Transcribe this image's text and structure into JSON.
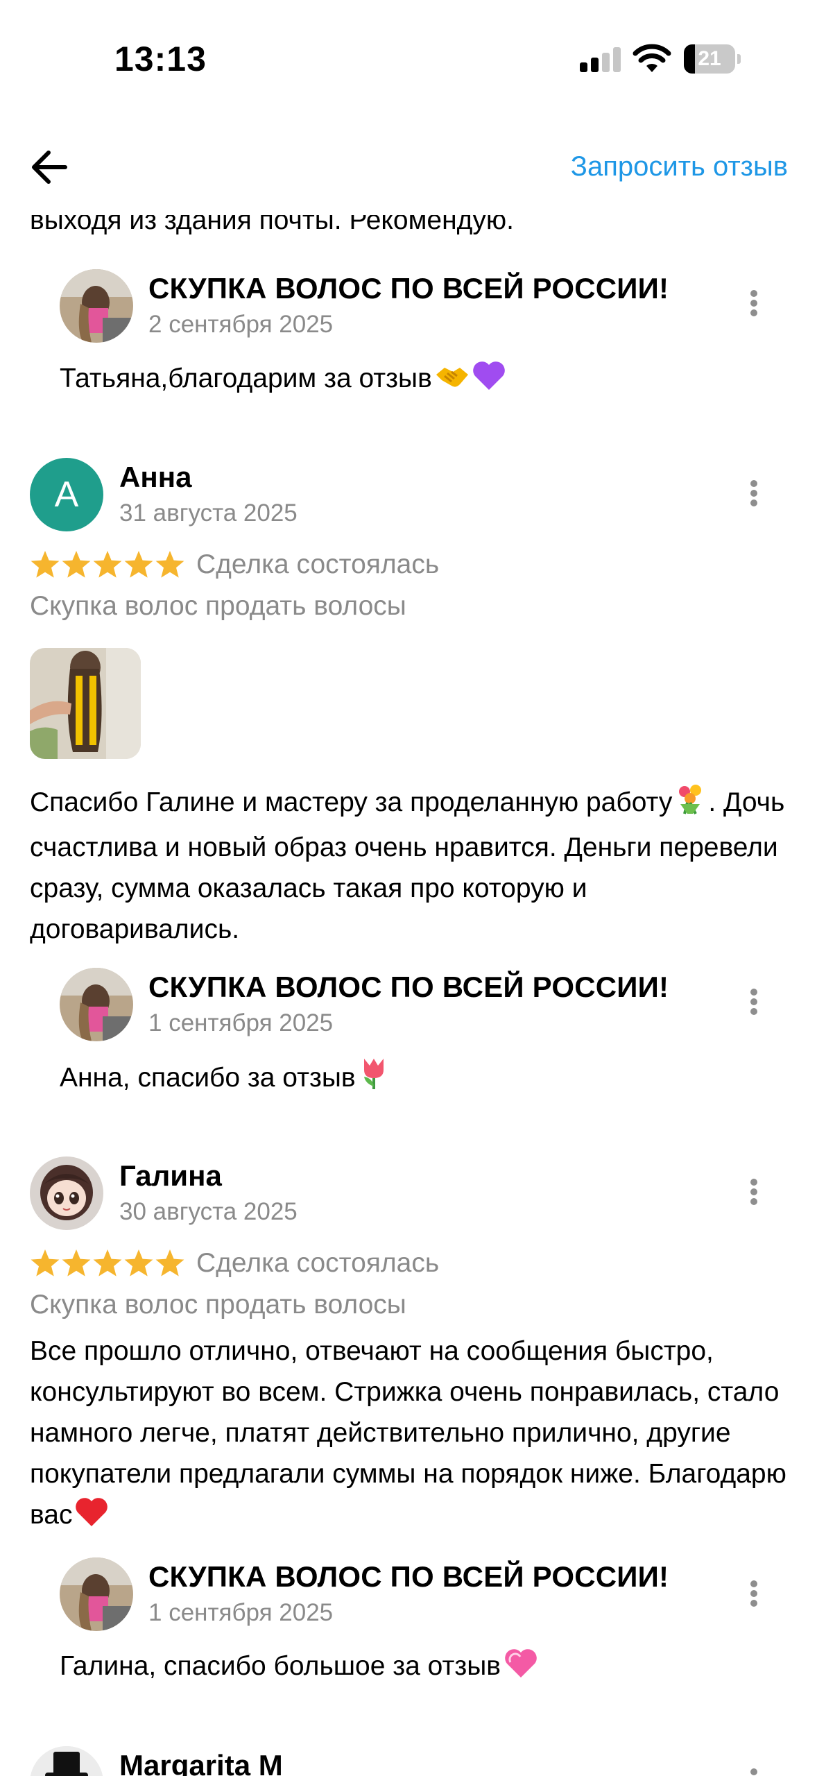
{
  "status_bar": {
    "time": "13:13",
    "battery": "21",
    "battery_level": 0.21
  },
  "nav": {
    "request_review_label": "Запросить отзыв"
  },
  "partial_top_text": "выходя из здания почты. Рекомендую.",
  "reviews": [
    {
      "reply": {
        "name": "СКУПКА ВОЛОС ПО ВСЕЙ РОССИИ!",
        "date": "2 сентября 2025",
        "text": "Татьяна,благодарим за отзыв",
        "emojis": [
          "handshake-emoji",
          "purple-heart-emoji"
        ]
      }
    },
    {
      "user": {
        "initial": "А",
        "avatar_color": "#1f9e8c",
        "name": "Анна",
        "date": "31 августа 2025",
        "rating": 5,
        "deal_status": "Сделка состоялась",
        "service": "Скупка волос продать волосы",
        "text": "Спасибо Галине и мастеру за проделанную работу",
        "text_after_emoji": ". Дочь счастлива и новый образ очень нравится. Деньги перевели сразу, сумма оказалась такая про которую и договаривались."
      },
      "reply": {
        "name": "СКУПКА ВОЛОС ПО ВСЕЙ РОССИИ!",
        "date": "1 сентября 2025",
        "text": "Анна, спасибо за отзыв",
        "emojis": [
          "tulip-emoji"
        ]
      }
    },
    {
      "user": {
        "name": "Галина",
        "date": "30 августа 2025",
        "rating": 5,
        "deal_status": "Сделка состоялась",
        "service": "Скупка волос продать волосы",
        "text": "Все прошло отлично, отвечают на сообщения быстро, консультируют во всем. Стрижка очень понравилась, стало намного легче, платят действительно прилично, другие покупатели предлагали суммы на порядок ниже. Благодарю вас"
      },
      "reply": {
        "name": "СКУПКА ВОЛОС ПО ВСЕЙ РОССИИ!",
        "date": "1 сентября 2025",
        "text": "Галина, спасибо большое за отзыв",
        "emojis": [
          "pink-heart-emoji"
        ]
      }
    },
    {
      "user": {
        "name": "Margarita M"
      }
    }
  ],
  "colors": {
    "accent": "#1e97e6",
    "star": "#f6b52e",
    "muted_text": "#8a8a8a",
    "avatar_teal": "#1f9e8c"
  }
}
